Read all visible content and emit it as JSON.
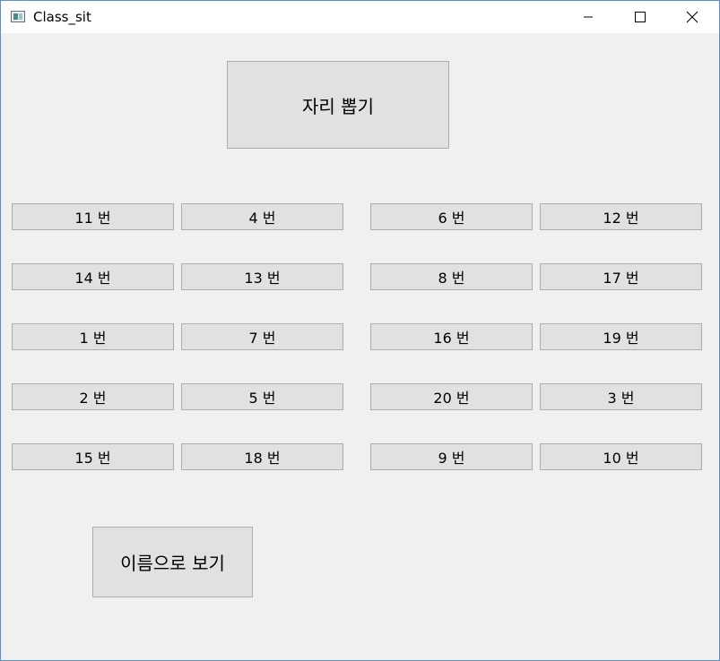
{
  "window": {
    "title": "Class_sit"
  },
  "actions": {
    "draw_seats_label": "자리 뽑기",
    "view_by_name_label": "이름으로 보기"
  },
  "seats": {
    "row1": [
      "11 번",
      "4 번",
      "6 번",
      "12 번"
    ],
    "row2": [
      "14 번",
      "13 번",
      "8 번",
      "17 번"
    ],
    "row3": [
      "1 번",
      "7 번",
      "16 번",
      "19 번"
    ],
    "row4": [
      "2 번",
      "5 번",
      "20 번",
      "3 번"
    ],
    "row5": [
      "15 번",
      "18 번",
      "9 번",
      "10 번"
    ]
  }
}
